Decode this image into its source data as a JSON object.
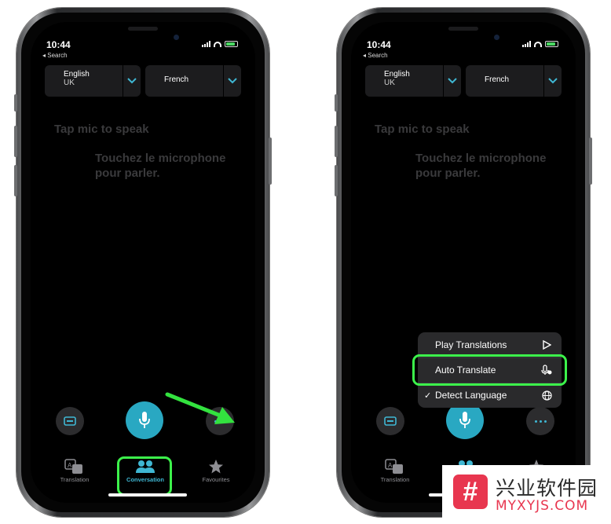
{
  "status": {
    "time": "10:44",
    "back_label": "◂ Search"
  },
  "languages": {
    "source": {
      "name": "English",
      "region": "UK"
    },
    "target": {
      "name": "French"
    }
  },
  "placeholders": {
    "source": "Tap mic to speak",
    "target": "Touchez le microphone pour parler."
  },
  "tabs": [
    {
      "label": "Translation",
      "icon": "translate-icon"
    },
    {
      "label": "Conversation",
      "icon": "people-icon",
      "active": true
    },
    {
      "label": "Favourites",
      "icon": "star-icon"
    }
  ],
  "menu": {
    "items": [
      {
        "label": "Play Translations",
        "icon": "play-icon"
      },
      {
        "label": "Auto Translate",
        "icon": "mic-wave-icon"
      },
      {
        "label": "Detect Language",
        "icon": "globe-icon",
        "checked": true,
        "check_mark": "✓"
      }
    ]
  },
  "watermark": {
    "chinese": "兴业软件园",
    "latin": "MYXYJS.COM",
    "logo_glyph": "#"
  },
  "colors": {
    "accent": "#3fb7d3",
    "highlight": "#3cf24b",
    "mic": "#29a8c2",
    "arrow": "#33e23f",
    "watermark": "#e8364f"
  }
}
